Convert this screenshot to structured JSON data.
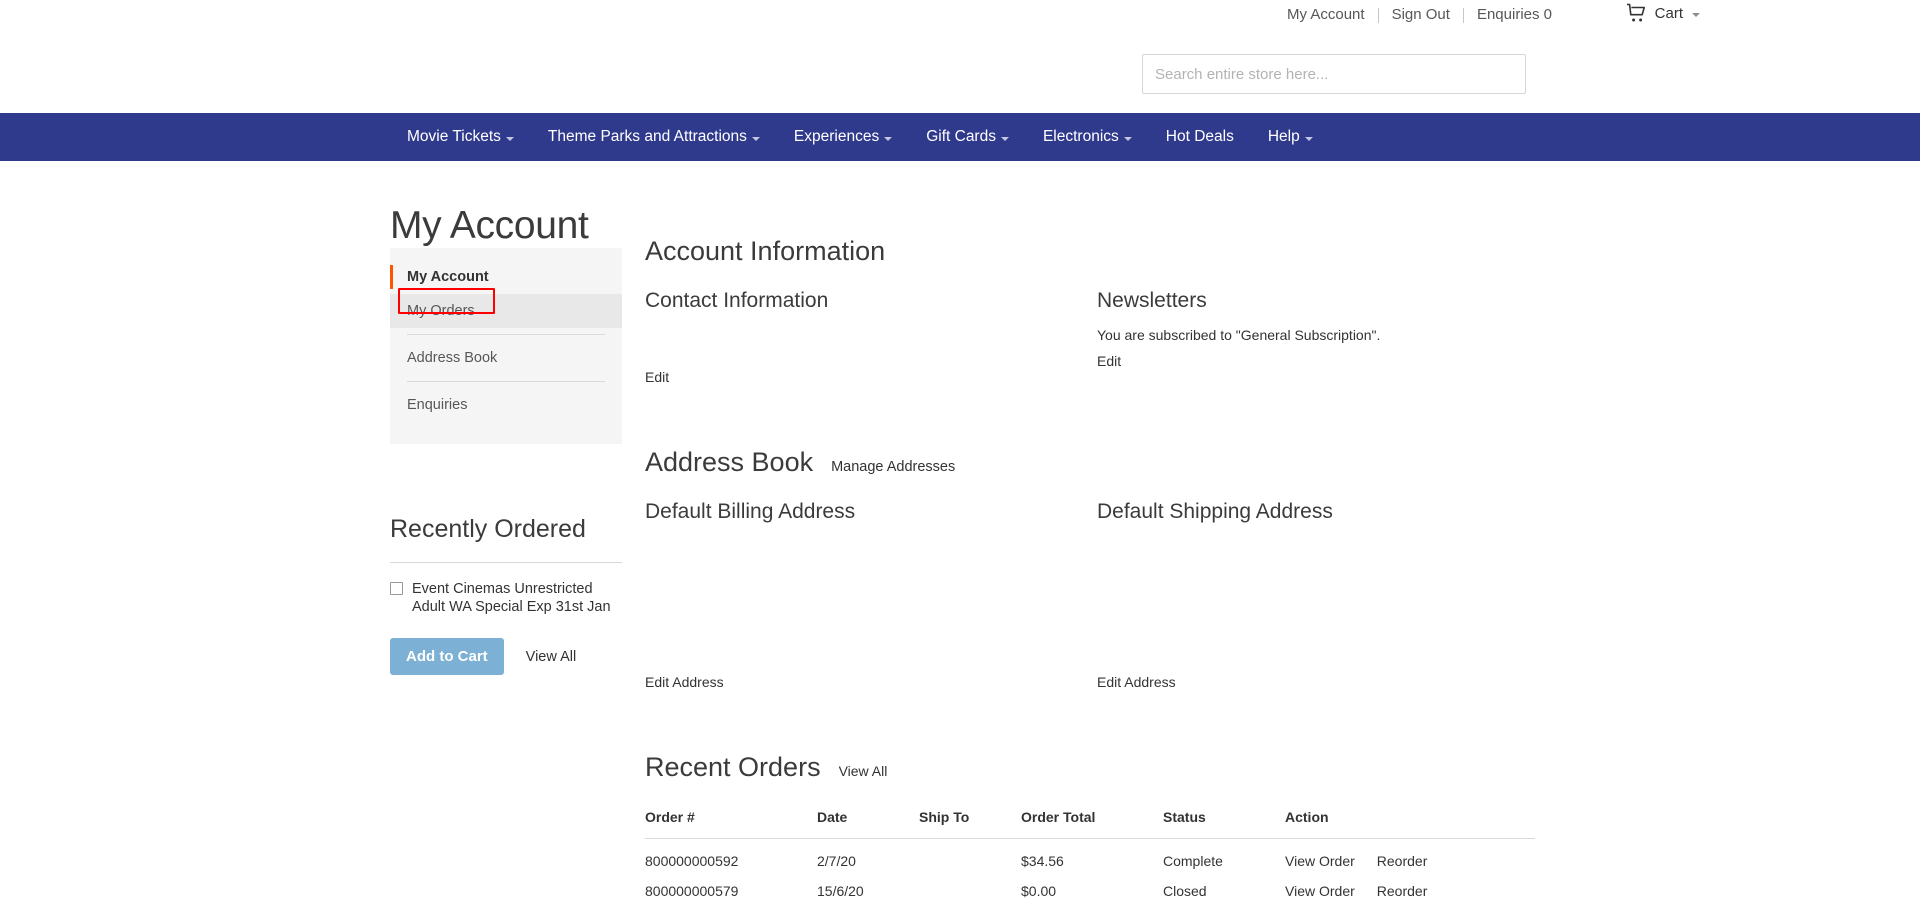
{
  "header": {
    "links": [
      {
        "label": "My Account",
        "name": "header-link-my-account"
      },
      {
        "label": "Sign Out",
        "name": "header-link-sign-out"
      },
      {
        "label": "Enquiries 0",
        "name": "header-link-enquiries"
      }
    ],
    "cart_label": "Cart",
    "cart_icon": "shopping-cart-icon"
  },
  "search": {
    "placeholder": "Search entire store here...",
    "value": ""
  },
  "mainnav": {
    "background": "#303a8c",
    "items": [
      {
        "label": "Movie Tickets",
        "caret": true
      },
      {
        "label": "Theme Parks and Attractions",
        "caret": true
      },
      {
        "label": "Experiences",
        "caret": true
      },
      {
        "label": "Gift Cards",
        "caret": true
      },
      {
        "label": "Electronics",
        "caret": true
      },
      {
        "label": "Hot Deals",
        "caret": false
      },
      {
        "label": "Help",
        "caret": true
      }
    ]
  },
  "page": {
    "title": "My Account"
  },
  "sidebar": {
    "items": [
      {
        "label": "My Account",
        "current": true,
        "active": false
      },
      {
        "label": "My Orders",
        "current": false,
        "active": true
      },
      {
        "label": "Address Book",
        "current": false,
        "active": false
      },
      {
        "label": "Enquiries",
        "current": false,
        "active": false
      }
    ],
    "annotation_color": "#ff0000",
    "accent_color": "#ff5501"
  },
  "recently_ordered": {
    "title": "Recently Ordered",
    "item_label": "Event Cinemas Unrestricted Adult WA Special Exp 31st Jan",
    "add_to_cart_label": "Add to Cart",
    "view_all_label": "View All",
    "button_color": "#7cb0d5"
  },
  "account_information": {
    "heading": "Account Information",
    "contact": {
      "heading": "Contact Information",
      "body": "",
      "edit_label": "Edit"
    },
    "newsletters": {
      "heading": "Newsletters",
      "body": "You are subscribed to \"General Subscription\".",
      "edit_label": "Edit"
    }
  },
  "address_book": {
    "heading": "Address Book",
    "manage_label": "Manage Addresses",
    "billing": {
      "heading": "Default Billing Address",
      "body": "",
      "edit_label": "Edit Address"
    },
    "shipping": {
      "heading": "Default Shipping Address",
      "body": "",
      "edit_label": "Edit Address"
    }
  },
  "recent_orders": {
    "heading": "Recent Orders",
    "view_all_label": "View All",
    "columns": [
      "Order #",
      "Date",
      "Ship To",
      "Order Total",
      "Status",
      "Action"
    ],
    "rows": [
      {
        "order": "800000000592",
        "date": "2/7/20",
        "ship_to": "",
        "total": "$34.56",
        "status": "Complete",
        "view_label": "View Order",
        "reorder_label": "Reorder"
      },
      {
        "order": "800000000579",
        "date": "15/6/20",
        "ship_to": "",
        "total": "$0.00",
        "status": "Closed",
        "view_label": "View Order",
        "reorder_label": "Reorder"
      }
    ]
  }
}
